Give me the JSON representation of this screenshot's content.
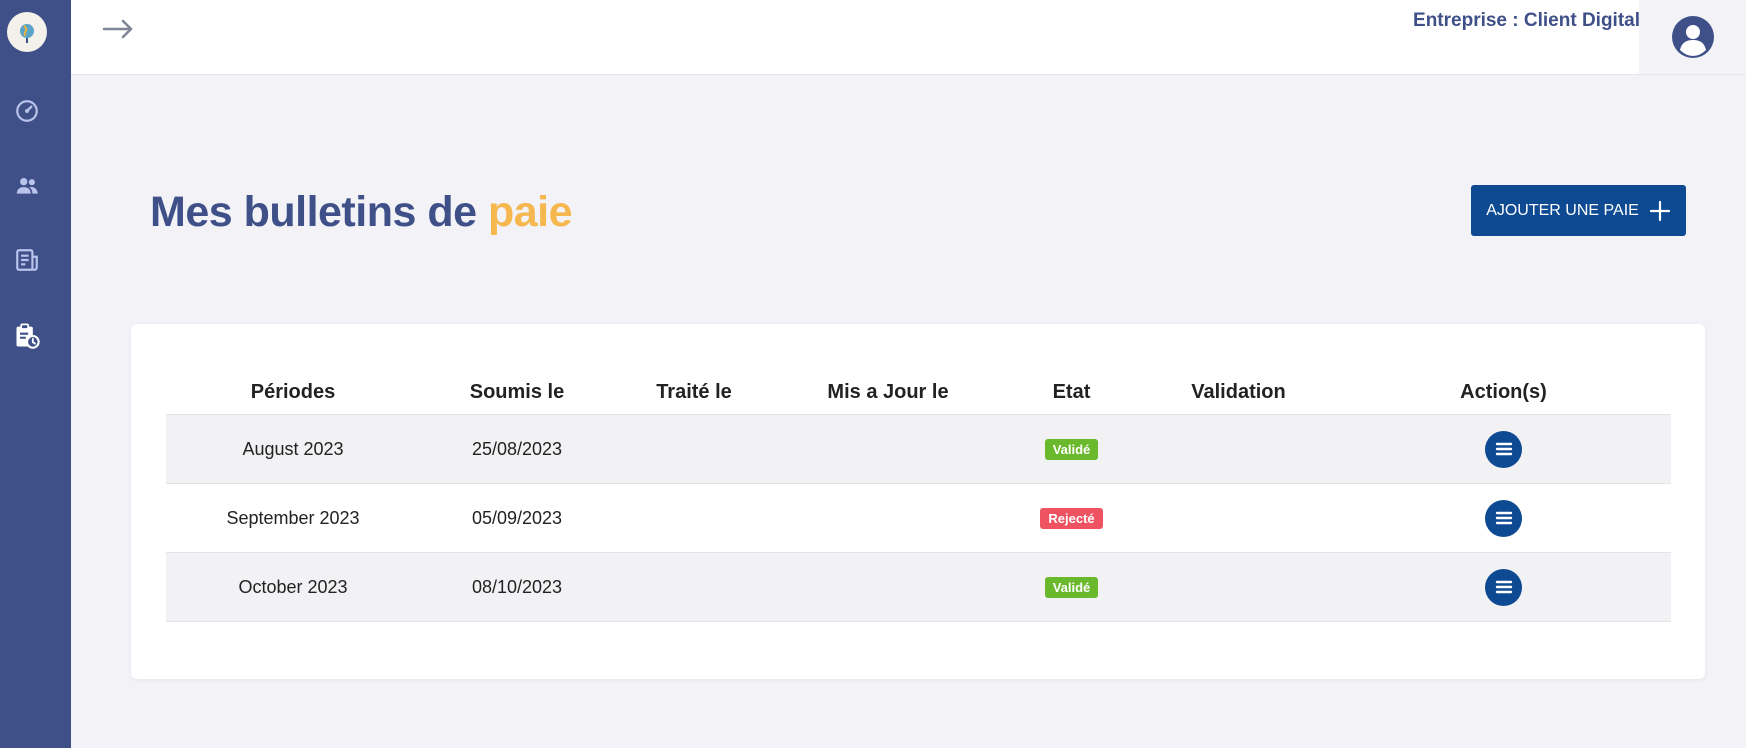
{
  "header": {
    "company_label": "Entreprise : Client Digital"
  },
  "sidebar": {
    "items": [
      {
        "icon": "speedometer-icon"
      },
      {
        "icon": "users-icon"
      },
      {
        "icon": "document-icon"
      },
      {
        "icon": "clipboard-clock-icon"
      }
    ]
  },
  "page": {
    "title_main": "Mes bulletins de ",
    "title_accent": "paie",
    "add_button_label": "AJOUTER UNE PAIE"
  },
  "table": {
    "columns": [
      "Périodes",
      "Soumis le",
      "Traité le",
      "Mis a Jour le",
      "Etat",
      "Validation",
      "Action(s)"
    ],
    "rows": [
      {
        "period": "August 2023",
        "submitted": "25/08/2023",
        "processed": "",
        "updated": "",
        "status": "Validé",
        "validation": ""
      },
      {
        "period": "September 2023",
        "submitted": "05/09/2023",
        "processed": "",
        "updated": "",
        "status": "Rejecté",
        "validation": ""
      },
      {
        "period": "October 2023",
        "submitted": "08/10/2023",
        "processed": "",
        "updated": "",
        "status": "Validé",
        "validation": ""
      }
    ]
  },
  "colors": {
    "primary": "#3f5089",
    "accent": "#f5b74e",
    "button": "#0d4a92",
    "status_valid": "#6ab82b",
    "status_rejected": "#ef5261"
  }
}
